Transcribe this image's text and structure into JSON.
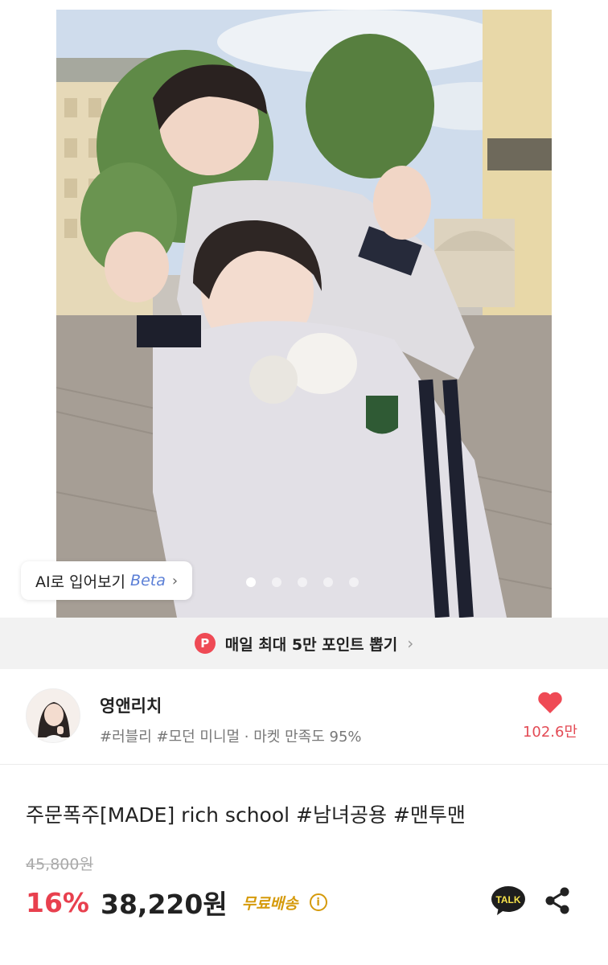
{
  "gallery": {
    "ai_try_label": "AI로 입어보기",
    "ai_try_beta": "Beta",
    "ai_try_chevron": "›",
    "dots_total": 5,
    "dots_active_index": 0
  },
  "promo": {
    "badge": "P",
    "text": "매일 최대 5만 포인트 뽑기",
    "chevron": "›"
  },
  "shop": {
    "name": "영앤리치",
    "tags": "#러블리 #모던 미니멀 · 마켓 만족도 95%",
    "like_count": "102.6만",
    "like_icon": "heart-icon"
  },
  "product": {
    "title": "주문폭주[MADE] rich school #남녀공용 #맨투맨",
    "original_price": "45,800원",
    "discount": "16%",
    "price": "38,220원",
    "shipping": "무료배송",
    "info_icon": "i"
  },
  "actions": {
    "talk_label": "TALK",
    "share_icon": "share-icon"
  },
  "colors": {
    "accent_red": "#e8404e",
    "shipping_gold": "#d59a0b",
    "heart": "#ef4a55"
  }
}
